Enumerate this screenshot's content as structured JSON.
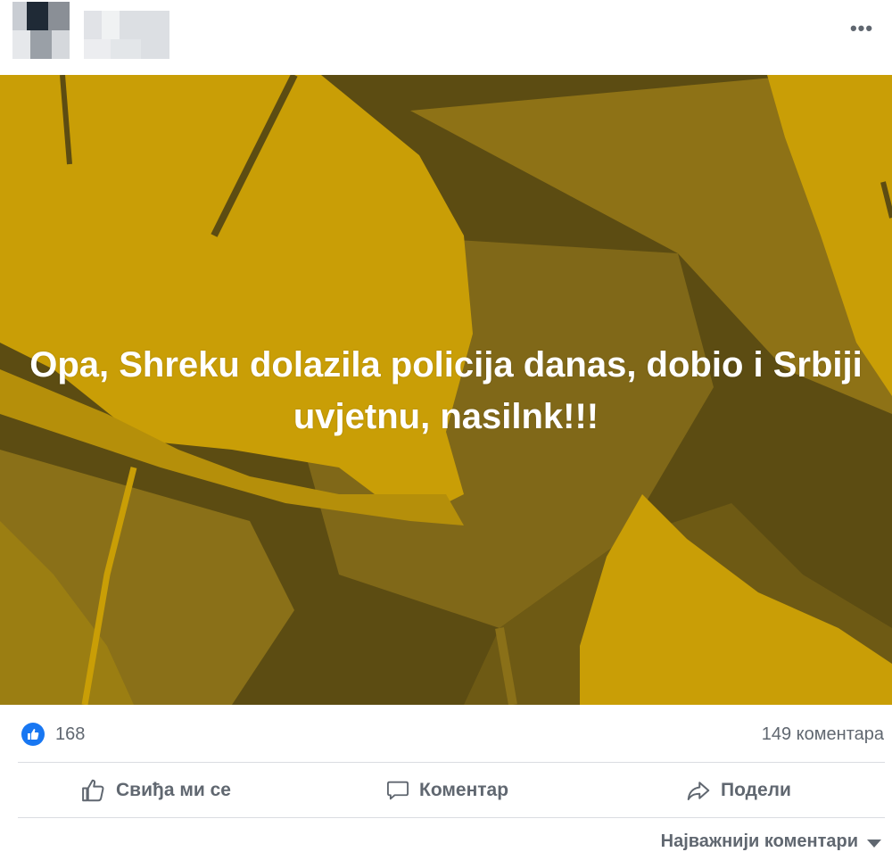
{
  "post": {
    "more_label": "•••",
    "text": "Opa, Shreku dolazila policija danas, dobio i Srbiji uvjetnu, nasilnk!!!",
    "background_colors": {
      "dark": "#5a4a12",
      "mid": "#8a7018",
      "leaf": "#c99e06",
      "leaf_light": "#d4a80a"
    }
  },
  "stats": {
    "like_icon": "thumbs-up-icon",
    "likes": "168",
    "comments": "149 коментара"
  },
  "actions": {
    "like_label": "Свиђа ми се",
    "comment_label": "Коментар",
    "share_label": "Подели"
  },
  "comments": {
    "sort_label": "Најважнији коментари"
  }
}
